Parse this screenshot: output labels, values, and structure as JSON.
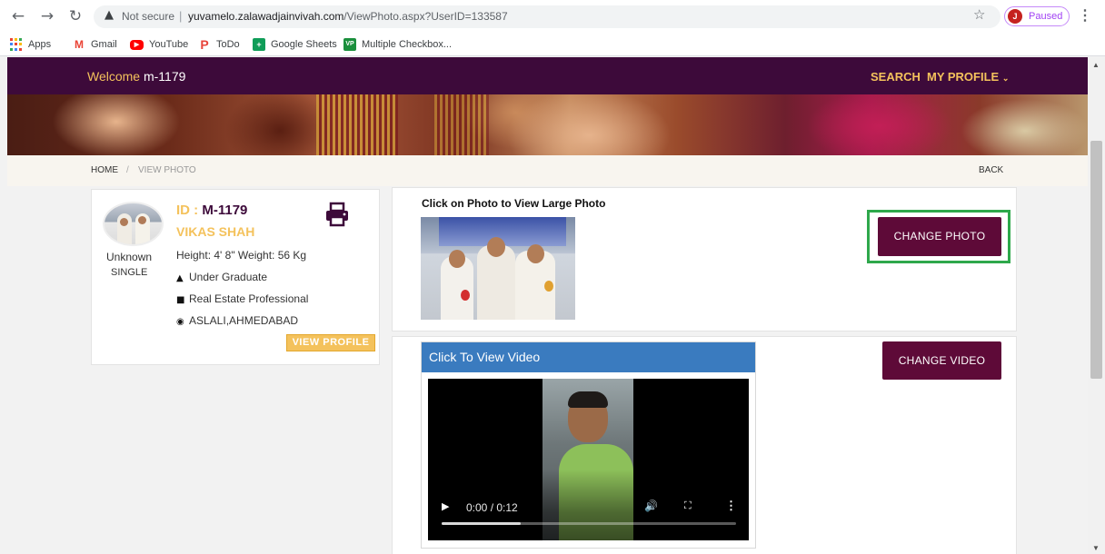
{
  "browser": {
    "insecure_label": "Not secure",
    "url_host": "yuvamelo.zalawadjainvivah.com",
    "url_path": "/ViewPhoto.aspx?UserID=133587",
    "profile_initial": "J",
    "profile_status": "Paused",
    "bookmarks": [
      "Apps",
      "Gmail",
      "YouTube",
      "ToDo",
      "Google Sheets",
      "Multiple Checkbox..."
    ]
  },
  "header": {
    "welcome_prefix": "Welcome",
    "username": "m-1179",
    "nav_search": "SEARCH",
    "nav_profile": "MY PROFILE"
  },
  "breadcrumb": {
    "home": "HOME",
    "separator": "/",
    "current": "VIEW PHOTO",
    "back": "BACK"
  },
  "profile": {
    "id_label": "ID :",
    "id_value": "M-1179",
    "name": "VIKAS SHAH",
    "status_top": "Unknown",
    "status_bottom": "SINGLE",
    "height_weight": "Height: 4' 8\"  Weight: 56 Kg",
    "education": "Under Graduate",
    "occupation": "Real Estate Professional",
    "location": "ASLALI,AHMEDABAD",
    "view_profile_label": "VIEW PROFILE"
  },
  "photo_section": {
    "caption": "Click on Photo to View Large Photo",
    "change_photo_label": "CHANGE PHOTO"
  },
  "video_section": {
    "title": "Click To View Video",
    "time_display": "0:00 / 0:12",
    "progress": 0.27,
    "change_video_label": "CHANGE VIDEO"
  },
  "colors": {
    "brand_dark": "#3d0a3a",
    "brand_gold": "#f4c25c",
    "button_maroon": "#5e0a38",
    "highlight_green": "#2ea84b",
    "video_header_blue": "#3a7bbf"
  }
}
